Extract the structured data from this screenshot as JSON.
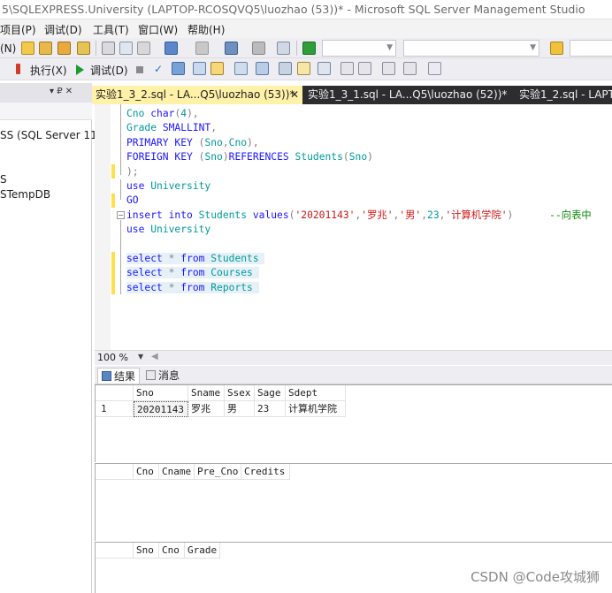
{
  "window": {
    "title": "5\\SQLEXPRESS.University (LAPTOP-RCOSQVQ5\\luozhao (53))* - Microsoft SQL Server Management Studio"
  },
  "menu": {
    "items": [
      "项目(P)",
      "调试(D)",
      "工具(T)",
      "窗口(W)",
      "帮助(H)"
    ]
  },
  "toolbar": {
    "n_label": "(N)",
    "execute_label": "执行(X)",
    "debug_label": "调试(D)"
  },
  "object_explorer": {
    "pin_glyph": "▾ ₽ ✕",
    "nodes": [
      "SS (SQL Server 11",
      "S",
      "STempDB"
    ]
  },
  "tabs": [
    {
      "label": "实验1_3_2.sql - LA...Q5\\luozhao (53))*",
      "active": true,
      "close": "✕"
    },
    {
      "label": "实验1_3_1.sql - LA...Q5\\luozhao (52))*",
      "active": false
    },
    {
      "label": "实验1_2.sql - LAPT.",
      "active": false
    }
  ],
  "editor": {
    "lines": [
      {
        "parts": [
          [
            "nm",
            "Cno "
          ],
          [
            "ty",
            "char"
          ],
          [
            "gr",
            "("
          ],
          [
            "nm",
            "4"
          ],
          [
            "gr",
            "),"
          ]
        ]
      },
      {
        "parts": [
          [
            "nm",
            "Grade "
          ],
          [
            "ty",
            "SMALLINT"
          ],
          [
            "gr",
            ","
          ]
        ]
      },
      {
        "parts": [
          [
            "kw",
            "PRIMARY KEY "
          ],
          [
            "gr",
            "("
          ],
          [
            "nm",
            "Sno"
          ],
          [
            "gr",
            ","
          ],
          [
            "nm",
            "Cno"
          ],
          [
            "gr",
            "),"
          ]
        ]
      },
      {
        "parts": [
          [
            "kw",
            "FOREIGN KEY "
          ],
          [
            "gr",
            "("
          ],
          [
            "nm",
            "Sno"
          ],
          [
            "gr",
            ")"
          ],
          [
            "kw",
            "REFERENCES "
          ],
          [
            "nm",
            "Students"
          ],
          [
            "gr",
            "("
          ],
          [
            "nm",
            "Sno"
          ],
          [
            "gr",
            ")"
          ]
        ]
      },
      {
        "parts": [
          [
            "gr",
            ");"
          ]
        ]
      },
      {
        "parts": [
          [
            "kw",
            "use "
          ],
          [
            "nm",
            "University"
          ]
        ]
      },
      {
        "parts": [
          [
            "kw",
            "GO"
          ]
        ]
      },
      {
        "parts": [
          [
            "kw",
            "insert into "
          ],
          [
            "nm",
            "Students "
          ],
          [
            "kw",
            "values"
          ],
          [
            "gr",
            "("
          ],
          [
            "rd",
            "'20201143'"
          ],
          [
            "gr",
            ","
          ],
          [
            "rd",
            "'罗兆'"
          ],
          [
            "gr",
            ","
          ],
          [
            "rd",
            "'男'"
          ],
          [
            "gr",
            ","
          ],
          [
            "nm",
            "23"
          ],
          [
            "gr",
            ","
          ],
          [
            "rd",
            "'计算机学院'"
          ],
          [
            "gr",
            ")"
          ],
          [
            "cm",
            "      --向表中"
          ]
        ]
      },
      {
        "parts": [
          [
            "kw",
            "use "
          ],
          [
            "nm",
            "University"
          ]
        ]
      },
      {
        "parts": [
          [
            "gr",
            ""
          ]
        ]
      },
      {
        "parts": [
          [
            "kw",
            "select "
          ],
          [
            "gr",
            "* "
          ],
          [
            "kw",
            "from "
          ],
          [
            "nm",
            "Students "
          ]
        ]
      },
      {
        "parts": [
          [
            "kw",
            "select "
          ],
          [
            "gr",
            "* "
          ],
          [
            "kw",
            "from "
          ],
          [
            "nm",
            "Courses "
          ]
        ]
      },
      {
        "parts": [
          [
            "kw",
            "select "
          ],
          [
            "gr",
            "* "
          ],
          [
            "kw",
            "from "
          ],
          [
            "nm",
            "Reports "
          ]
        ]
      }
    ]
  },
  "zoom": {
    "value": "100 %"
  },
  "results_tabs": [
    {
      "label": "结果",
      "active": true
    },
    {
      "label": "消息",
      "active": false
    }
  ],
  "grids": [
    {
      "columns": [
        "Sno",
        "Sname",
        "Ssex",
        "Sage",
        "Sdept"
      ],
      "rows": [
        {
          "num": "1",
          "cells": [
            "20201143",
            "罗兆",
            "男",
            "23",
            "计算机学院"
          ]
        }
      ]
    },
    {
      "columns": [
        "Cno",
        "Cname",
        "Pre_Cno",
        "Credits"
      ],
      "rows": []
    },
    {
      "columns": [
        "Sno",
        "Cno",
        "Grade"
      ],
      "rows": []
    }
  ],
  "watermark": "CSDN @Code攻城狮"
}
